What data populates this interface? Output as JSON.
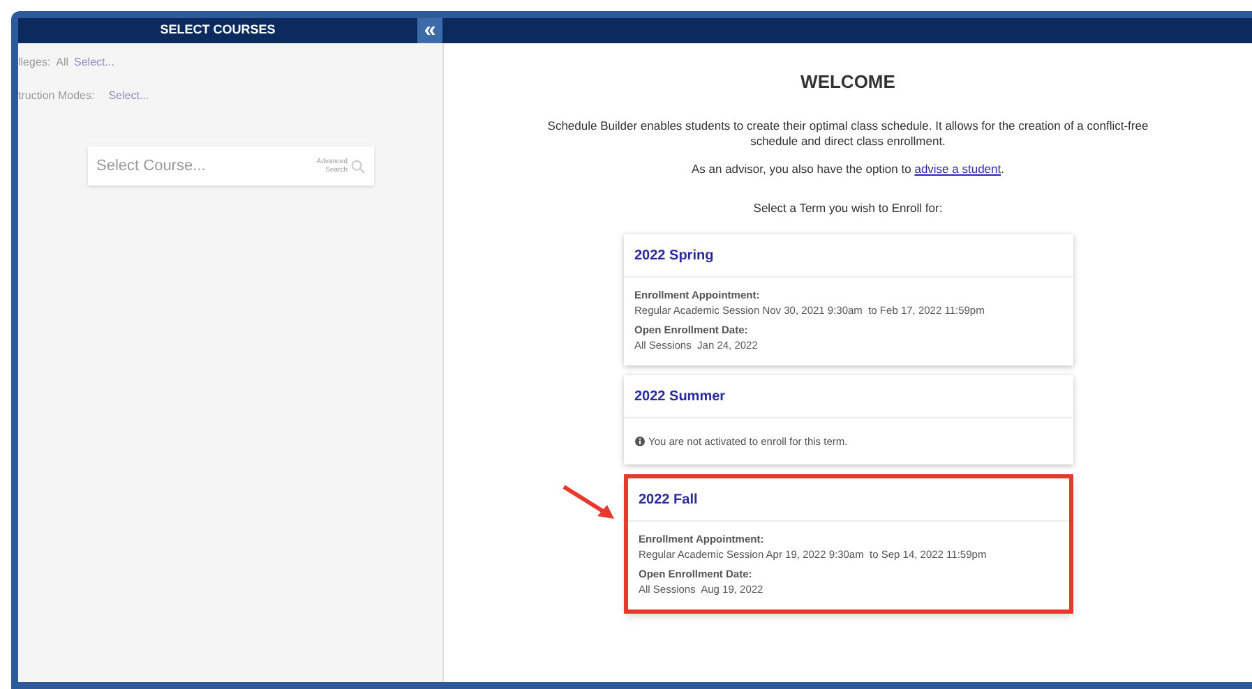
{
  "sidebar": {
    "title": "SELECT COURSES",
    "collapse_button": "«",
    "filters": [
      {
        "label": "lleges:",
        "value": "All",
        "action": "Select..."
      },
      {
        "label": "truction Modes:",
        "action": "Select..."
      }
    ],
    "course_search": {
      "placeholder": "Select Course...",
      "advanced": "Advanced Search"
    }
  },
  "main": {
    "title": "WELCOME",
    "intro": "Schedule Builder enables students to create their optimal class schedule. It allows for the creation of a conflict-free schedule and direct class enrollment.",
    "advisor_text": "As an advisor, you also have the option to",
    "advisor_link": "advise a student",
    "advisor_end": ".",
    "prompt": "Select a Term you wish to Enroll for:",
    "terms": [
      {
        "title": "2022 Spring",
        "kind": "appointment",
        "highlighted": false,
        "appointment_label": "Enrollment Appointment:",
        "appointment": "Regular Academic Session Nov 30, 2021 9:30am  to Feb 17, 2022 11:59pm",
        "open_label": "Open Enrollment Date:",
        "open": "All Sessions  Jan 24, 2022"
      },
      {
        "title": "2022 Summer",
        "kind": "inactive",
        "highlighted": false,
        "message": "You are not activated to enroll for this term."
      },
      {
        "title": "2022 Fall",
        "kind": "appointment",
        "highlighted": true,
        "appointment_label": "Enrollment Appointment:",
        "appointment": "Regular Academic Session Apr 19, 2022 9:30am  to Sep 14, 2022 11:59pm",
        "open_label": "Open Enrollment Date:",
        "open": "All Sessions  Aug 19, 2022"
      }
    ]
  }
}
